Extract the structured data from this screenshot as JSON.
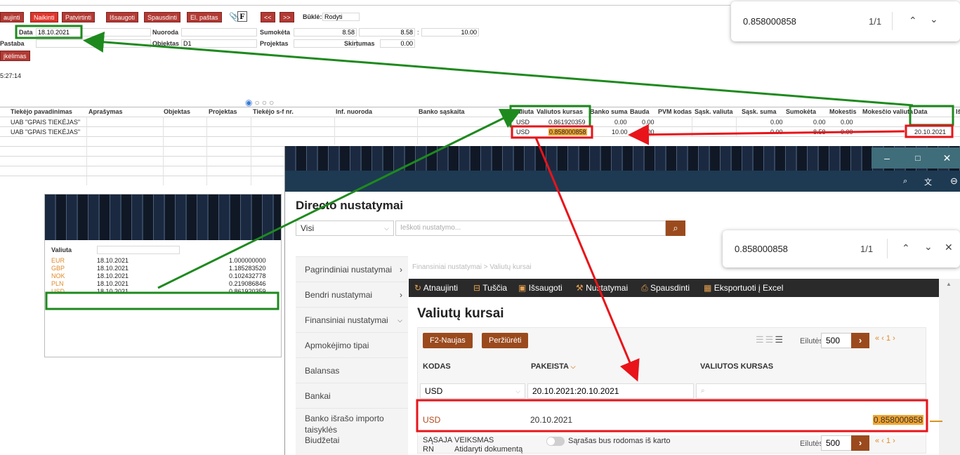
{
  "toolbar": {
    "buttons": [
      "aujinti",
      "Naikinti",
      "Patvirtinti",
      "Išsaugoti",
      "Spausdinti",
      "El. paštas"
    ],
    "icon_f": "F",
    "prev": "<<",
    "next": ">>",
    "status_label": "Būklė:",
    "status_value": "Rodyti"
  },
  "form": {
    "data_label": "Data",
    "data_value": "18.10.2021",
    "nuoroda_label": "Nuoroda",
    "sumoketa_label": "Sumokėta",
    "sumoketa_1": "8.58",
    "sumoketa_2": "8.58",
    "sumoketa_sep": ":",
    "sumoketa_3": "10.00",
    "pastaba_label": "Pastaba",
    "objektas_label": "Objektas",
    "objektas_value": "D1",
    "projektas_label": "Projektas",
    "skirtumas_label": "Skirtumas",
    "skirtumas_value": "0.00",
    "ikelimas_button": "įkėlimas",
    "time": "5:27:14"
  },
  "find_top": {
    "query": "0.858000858",
    "count": "1/1"
  },
  "grid": {
    "headers": [
      "Tiekėjo pavadinimas",
      "Aprašymas",
      "Objektas",
      "Projektas",
      "Tiekėjo s-f nr.",
      "Inf. nuoroda",
      "Banko sąskaita",
      "Valiuta",
      "Valiutos kursas",
      "Banko suma",
      "Bauda",
      "PVM kodas",
      "Sąsk. valiuta",
      "Sąsk. suma",
      "Sumokėta",
      "Mokestis",
      "Mokesčio valiuta",
      "Data",
      "Iš"
    ],
    "rows": [
      {
        "supplier": "UAB \"GPAIS TIEKĖJAS\"",
        "currency": "USD",
        "rate": "0.861920359",
        "bank_sum": "0.00",
        "fine": "0.00",
        "inv_sum": "0.00",
        "paid": "0.00",
        "fee": "0.00",
        "date": ""
      },
      {
        "supplier": "UAB \"GPAIS TIEKĖJAS\"",
        "currency": "USD",
        "rate": "0.858000858",
        "bank_sum": "10.00",
        "fine": "0.00",
        "inv_sum": "0.00",
        "paid": "8.58",
        "fee": "0.00",
        "date": "20.10.2021"
      }
    ]
  },
  "rates_panel": {
    "header": "Valiuta",
    "rows": [
      {
        "code": "EUR",
        "date": "18.10.2021",
        "rate": "1.000000000"
      },
      {
        "code": "GBP",
        "date": "18.10.2021",
        "rate": "1.185283520"
      },
      {
        "code": "NOK",
        "date": "18.10.2021",
        "rate": "0.102432778"
      },
      {
        "code": "PLN",
        "date": "18.10.2021",
        "rate": "0.219086846"
      },
      {
        "code": "USD",
        "date": "18.10.2021",
        "rate": "0.861920359"
      }
    ]
  },
  "directo": {
    "title": "Directo nustatymai",
    "filter_select": "Visi",
    "search_placeholder": "Ieškoti nustatymo...",
    "find": {
      "query": "0.858000858",
      "count": "1/1"
    },
    "sidebar": [
      "Pagrindiniai nustatymai",
      "Bendri nustatymai",
      "Finansiniai nustatymai",
      "Apmokėjimo tipai",
      "Balansas",
      "Bankai",
      "Banko išrašo importo taisyklės",
      "Biudžetai"
    ],
    "breadcrumb": "Finansiniai nustatymai > Valiutų kursai",
    "actions": [
      "Atnaujinti",
      "Tuščia",
      "Išsaugoti",
      "Nustatymai",
      "Spausdinti",
      "Eksportuoti į Excel"
    ],
    "page_title": "Valiutų kursai",
    "new_button": "F2-Naujas",
    "view_button": "Peržiūrėti",
    "rows_label": "Eilutės:",
    "rows_value": "500",
    "page_nav": "«  ‹  1 ›",
    "columns": [
      "KODAS",
      "PAKEISTA",
      "VALIUTOS KURSAS"
    ],
    "filter_code": "USD",
    "filter_date": "20.10.2021:20.10.2021",
    "result": {
      "code": "USD",
      "date": "20.10.2021",
      "rate": "0.858000858"
    },
    "footer": {
      "left1": "SĄSAJA",
      "left2": "RN",
      "mid1": "VEIKSMAS",
      "mid2": "Atidaryti dokumentą",
      "toggle_label": "Sąrašas bus rodomas iš karto"
    }
  },
  "colors": {
    "highlight_green": "#1e8a1e",
    "highlight_red": "#e8141a",
    "accent_orange": "#9b4a1d",
    "toolbar_red": "#b33a34"
  }
}
